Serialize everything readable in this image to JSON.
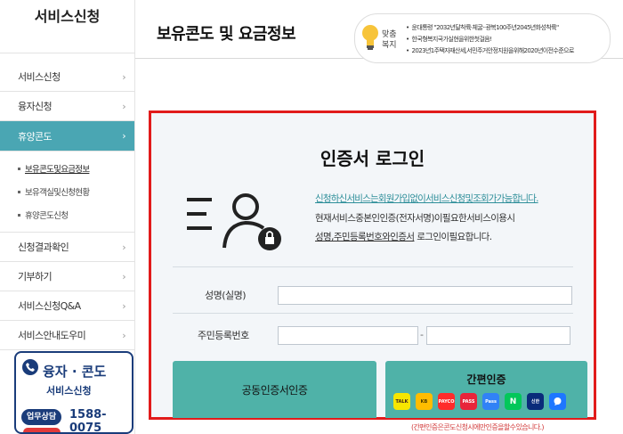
{
  "sidebar": {
    "title": "서비스신청",
    "items": [
      {
        "label": "서비스신청",
        "chev": "›"
      },
      {
        "label": "융자신청",
        "chev": "›"
      },
      {
        "label": "휴양콘도",
        "chev": "›"
      }
    ],
    "sub_items": [
      {
        "label": "보유콘도및요금정보"
      },
      {
        "label": "보유객실및신청현황"
      },
      {
        "label": "휴양콘도신청"
      }
    ],
    "items_after": [
      {
        "label": "신청결과확인",
        "chev": "›"
      },
      {
        "label": "기부하기",
        "chev": "›"
      },
      {
        "label": "서비스신청Q&A",
        "chev": "›"
      },
      {
        "label": "서비스안내도우미",
        "chev": "›"
      }
    ],
    "promo": {
      "title": "융자 · 콘도",
      "subtitle": "서비스신청",
      "badge": "업무상담",
      "phone": "1588-0075"
    }
  },
  "header": {
    "title": "보유콘도 및 요금정보"
  },
  "welfare_banner": {
    "label_line1": "맞춤",
    "label_line2": "복지",
    "news": [
      "윤대통령 \"2032년달착륙·체굴··광복100주년2045년화성착륙\"",
      "한국형복지국가실현을위한첫걸음!",
      "2023년1주택자재산세,서민주거안정지원을위해2020년이전수준으로"
    ]
  },
  "login": {
    "title": "인증서 로그인",
    "notice_link": "신청하신서비스는회원가입없이서비스신청및조회가가능합니다.",
    "notice_line2": "현재서비스중본인인증(전자서명)이필요한서비스이용시",
    "notice_line3_u": "성명,주민등록번호와인증서",
    "notice_line3_rest": " 로그인이필요합니다.",
    "name_label": "성명(실명)",
    "rrn_label": "주민등록번호",
    "rrn_dash": "-",
    "cert_button": "공동인증서인증",
    "simple_button": "간편인증",
    "auth_providers": [
      {
        "name": "kakao-icon",
        "text": "TALK",
        "bg": "#f7e600",
        "fg": "#3a1d1d"
      },
      {
        "name": "kb-icon",
        "text": "KB",
        "bg": "#ffbc00",
        "fg": "#4a3a00"
      },
      {
        "name": "payco-icon",
        "text": "PAYCO",
        "bg": "#ff2b2b",
        "fg": "#ffffff"
      },
      {
        "name": "pass-icon",
        "text": "PASS",
        "bg": "#e8243a",
        "fg": "#ffffff"
      },
      {
        "name": "toss-icon",
        "text": "Pass",
        "bg": "#3182f6",
        "fg": "#ffffff"
      },
      {
        "name": "naver-icon",
        "text": "N",
        "bg": "#03c75a",
        "fg": "#ffffff"
      },
      {
        "name": "shinhan-icon",
        "text": "신한",
        "bg": "#0a2b7a",
        "fg": "#ffffff"
      },
      {
        "name": "chat-icon",
        "text": "",
        "bg": "#1e77ff",
        "fg": "#ffffff"
      }
    ],
    "foot_note": "(간편인증은콘도신청시에만인증을할수있습니다.)"
  }
}
